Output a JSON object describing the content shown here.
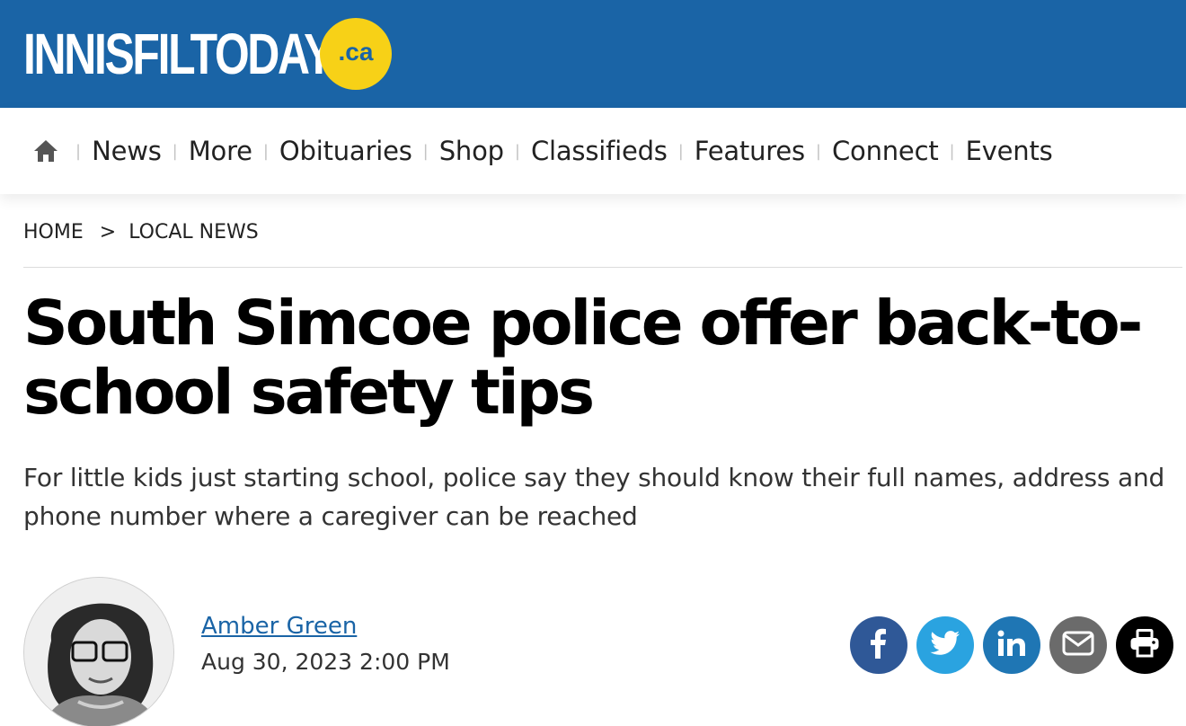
{
  "site": {
    "logo_text": "INNISFILTODAY",
    "logo_suffix": ".ca",
    "brand_color": "#1a64a6",
    "badge_color": "#f7d117"
  },
  "nav": {
    "home_icon": "home-icon",
    "items": [
      "News",
      "More",
      "Obituaries",
      "Shop",
      "Classifieds",
      "Features",
      "Connect",
      "Events"
    ]
  },
  "breadcrumb": {
    "home": "HOME",
    "separator": ">",
    "section": "LOCAL NEWS"
  },
  "article": {
    "headline": "South Simcoe police offer back-to-school safety tips",
    "dek": "For little kids just starting school, police say they should know their full names, address and phone number where a caregiver can be reached",
    "author": "Amber Green",
    "date": "Aug 30, 2023 2:00 PM"
  },
  "share": [
    {
      "name": "facebook",
      "icon": "facebook-icon",
      "color": "#2f5897"
    },
    {
      "name": "twitter",
      "icon": "twitter-icon",
      "color": "#2aa3e0"
    },
    {
      "name": "linkedin",
      "icon": "linkedin-icon",
      "color": "#1f76b4"
    },
    {
      "name": "email",
      "icon": "email-icon",
      "color": "#6b6b6b"
    },
    {
      "name": "print",
      "icon": "print-icon",
      "color": "#000000"
    }
  ]
}
